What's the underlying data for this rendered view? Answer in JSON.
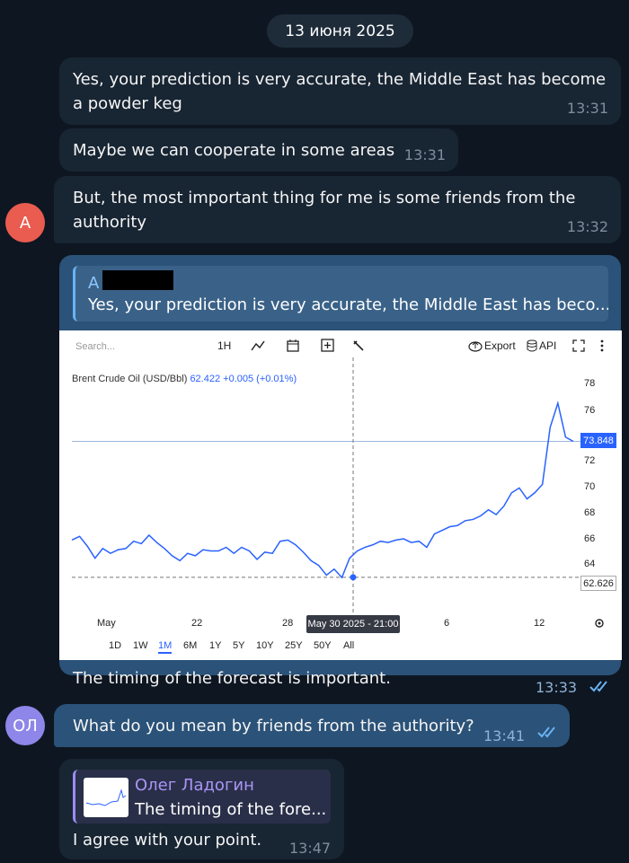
{
  "date_label": "13 июня 2025",
  "messages": [
    {
      "text": "Yes, your prediction is very accurate, the Middle East has become a powder keg",
      "time": "13:31"
    },
    {
      "text": "Maybe we can cooperate in some areas",
      "time": "13:31"
    },
    {
      "text": "But, the most important thing for me is some friends from the authority",
      "time": "13:32"
    }
  ],
  "avatar_a": {
    "letter": "A",
    "color": "#e95c4f"
  },
  "avatar_ol": {
    "letter": "ОЛ",
    "color": "#8e86e8"
  },
  "outgoing_chart_msg": {
    "reply_name": "A",
    "reply_text": "Yes, your prediction is very accurate, the Middle East has beco...",
    "text": "The timing of the forecast is important.",
    "time": "13:33"
  },
  "outgoing_msg2": {
    "text": "What do you mean by friends from the authority?",
    "time": "13:41"
  },
  "incoming_last": {
    "reply_name": "Олег Ладогин",
    "reply_text": "The timing of the fore...",
    "text": "I agree with your point.",
    "time": "13:47"
  },
  "chart_toolbar": {
    "search_placeholder": "Search...",
    "interval": "1H",
    "export": "Export",
    "api": "API"
  },
  "chart_data": {
    "type": "line",
    "title": "Brent Crude Oil (USD/Bbl)",
    "legend_value": "62.422",
    "legend_change": "+0.005 (+0.01%)",
    "ylim": [
      61.5,
      79
    ],
    "y_ticks": [
      "78",
      "76",
      "74",
      "72",
      "70",
      "68",
      "66",
      "64"
    ],
    "last_price": "73.848",
    "crosshair_price": "62.626",
    "x_ticks": [
      "May",
      "22",
      "28",
      "6",
      "12"
    ],
    "crosshair_date": "May 30 2025 - 21:00",
    "ranges": [
      "1D",
      "1W",
      "1M",
      "6M",
      "1Y",
      "5Y",
      "10Y",
      "25Y",
      "50Y",
      "All"
    ],
    "active_range": "1M",
    "line_color": "#2962ff",
    "series": [
      {
        "values": [
          65.7,
          66.0,
          65.2,
          64.2,
          65.0,
          64.6,
          64.9,
          65.0,
          65.6,
          65.4,
          66.1,
          65.5,
          65.0,
          64.4,
          64.0,
          64.6,
          64.4,
          64.9,
          64.8,
          64.8,
          65.1,
          64.6,
          65.1,
          64.8,
          64.1,
          64.7,
          64.6,
          65.6,
          65.7,
          65.3,
          64.7,
          64.0,
          63.6,
          62.8,
          63.3,
          62.6,
          64.2,
          64.8,
          65.1,
          65.3,
          65.6,
          65.5,
          65.7,
          65.8,
          65.5,
          65.6,
          65.1,
          66.2,
          66.5,
          66.8,
          66.9,
          67.3,
          67.4,
          67.7,
          68.2,
          67.8,
          68.5,
          69.6,
          70.0,
          69.1,
          69.6,
          70.3,
          75.0,
          77.0,
          74.2,
          73.848
        ]
      }
    ]
  }
}
